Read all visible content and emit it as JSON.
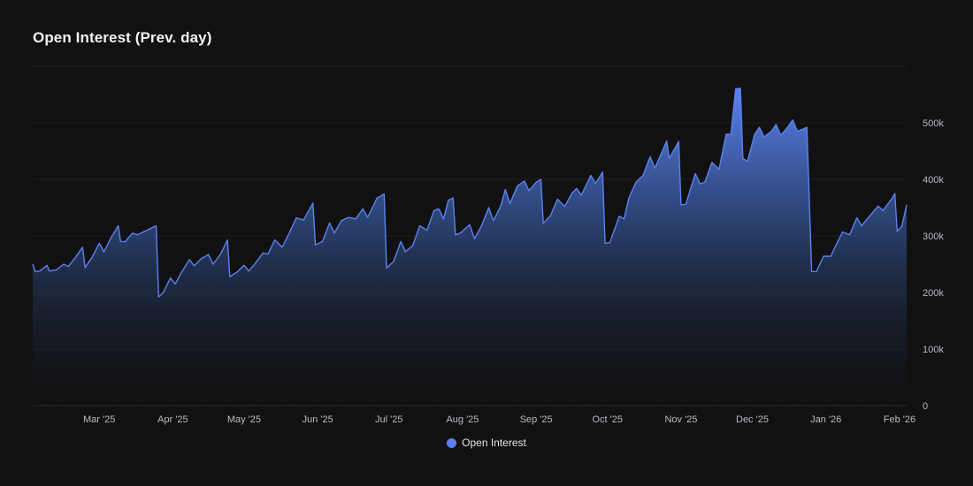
{
  "title": "Open Interest (Prev. day)",
  "legend": {
    "label": "Open Interest",
    "color": "#5b82f0"
  },
  "chart_data": {
    "type": "area",
    "title": "Open Interest (Prev. day)",
    "y_axis_position": "right",
    "grid": true,
    "legend_position": "bottom-center",
    "ylim": [
      0,
      600000
    ],
    "yticks": [
      0,
      100000,
      200000,
      300000,
      400000,
      500000
    ],
    "ytick_labels": [
      "0",
      "100k",
      "200k",
      "300k",
      "400k",
      "500k"
    ],
    "xticks": [
      {
        "date": "2025-03-01",
        "label": "Mar '25"
      },
      {
        "date": "2025-04-01",
        "label": "Apr '25"
      },
      {
        "date": "2025-05-01",
        "label": "May '25"
      },
      {
        "date": "2025-06-01",
        "label": "Jun '25"
      },
      {
        "date": "2025-07-01",
        "label": "Jul '25"
      },
      {
        "date": "2025-08-01",
        "label": "Aug '25"
      },
      {
        "date": "2025-09-01",
        "label": "Sep '25"
      },
      {
        "date": "2025-10-01",
        "label": "Oct '25"
      },
      {
        "date": "2025-11-01",
        "label": "Nov '25"
      },
      {
        "date": "2025-12-01",
        "label": "Dec '25"
      },
      {
        "date": "2026-01-01",
        "label": "Jan '26"
      },
      {
        "date": "2026-02-01",
        "label": "Feb '26"
      }
    ],
    "x_range": [
      "2025-02-01",
      "2026-02-01"
    ],
    "series": [
      {
        "name": "Open Interest",
        "color": "#5b82f0",
        "points": [
          [
            "2025-02-01",
            250000
          ],
          [
            "2025-02-02",
            237000
          ],
          [
            "2025-02-04",
            238000
          ],
          [
            "2025-02-07",
            248000
          ],
          [
            "2025-02-08",
            238000
          ],
          [
            "2025-02-11",
            240000
          ],
          [
            "2025-02-14",
            250000
          ],
          [
            "2025-02-16",
            246000
          ],
          [
            "2025-02-19",
            262000
          ],
          [
            "2025-02-22",
            280000
          ],
          [
            "2025-02-23",
            244000
          ],
          [
            "2025-02-26",
            262000
          ],
          [
            "2025-03-01",
            287000
          ],
          [
            "2025-03-03",
            272000
          ],
          [
            "2025-03-06",
            297000
          ],
          [
            "2025-03-09",
            318000
          ],
          [
            "2025-03-10",
            290000
          ],
          [
            "2025-03-12",
            290000
          ],
          [
            "2025-03-15",
            305000
          ],
          [
            "2025-03-17",
            302000
          ],
          [
            "2025-03-21",
            310000
          ],
          [
            "2025-03-25",
            318000
          ],
          [
            "2025-03-26",
            192000
          ],
          [
            "2025-03-28",
            200000
          ],
          [
            "2025-03-31",
            226000
          ],
          [
            "2025-04-02",
            215000
          ],
          [
            "2025-04-05",
            238000
          ],
          [
            "2025-04-08",
            258000
          ],
          [
            "2025-04-10",
            247000
          ],
          [
            "2025-04-13",
            260000
          ],
          [
            "2025-04-16",
            267000
          ],
          [
            "2025-04-18",
            250000
          ],
          [
            "2025-04-21",
            267000
          ],
          [
            "2025-04-24",
            293000
          ],
          [
            "2025-04-25",
            228000
          ],
          [
            "2025-04-28",
            236000
          ],
          [
            "2025-05-01",
            248000
          ],
          [
            "2025-05-03",
            238000
          ],
          [
            "2025-05-06",
            253000
          ],
          [
            "2025-05-09",
            270000
          ],
          [
            "2025-05-11",
            268000
          ],
          [
            "2025-05-14",
            293000
          ],
          [
            "2025-05-17",
            280000
          ],
          [
            "2025-05-20",
            305000
          ],
          [
            "2025-05-23",
            332000
          ],
          [
            "2025-05-26",
            328000
          ],
          [
            "2025-05-30",
            358000
          ],
          [
            "2025-05-31",
            284000
          ],
          [
            "2025-06-03",
            290000
          ],
          [
            "2025-06-06",
            323000
          ],
          [
            "2025-06-08",
            305000
          ],
          [
            "2025-06-11",
            327000
          ],
          [
            "2025-06-14",
            333000
          ],
          [
            "2025-06-17",
            330000
          ],
          [
            "2025-06-20",
            348000
          ],
          [
            "2025-06-22",
            333000
          ],
          [
            "2025-06-26",
            367000
          ],
          [
            "2025-06-29",
            374000
          ],
          [
            "2025-06-30",
            243000
          ],
          [
            "2025-07-03",
            255000
          ],
          [
            "2025-07-06",
            290000
          ],
          [
            "2025-07-08",
            272000
          ],
          [
            "2025-07-11",
            283000
          ],
          [
            "2025-07-14",
            318000
          ],
          [
            "2025-07-17",
            310000
          ],
          [
            "2025-07-20",
            345000
          ],
          [
            "2025-07-22",
            348000
          ],
          [
            "2025-07-24",
            330000
          ],
          [
            "2025-07-26",
            363000
          ],
          [
            "2025-07-28",
            367000
          ],
          [
            "2025-07-29",
            302000
          ],
          [
            "2025-07-31",
            305000
          ],
          [
            "2025-08-04",
            320000
          ],
          [
            "2025-08-06",
            295000
          ],
          [
            "2025-08-09",
            318000
          ],
          [
            "2025-08-12",
            350000
          ],
          [
            "2025-08-14",
            327000
          ],
          [
            "2025-08-17",
            352000
          ],
          [
            "2025-08-19",
            382000
          ],
          [
            "2025-08-21",
            357000
          ],
          [
            "2025-08-24",
            388000
          ],
          [
            "2025-08-27",
            397000
          ],
          [
            "2025-08-29",
            380000
          ],
          [
            "2025-09-01",
            395000
          ],
          [
            "2025-09-03",
            400000
          ],
          [
            "2025-09-04",
            322000
          ],
          [
            "2025-09-07",
            336000
          ],
          [
            "2025-09-10",
            365000
          ],
          [
            "2025-09-13",
            352000
          ],
          [
            "2025-09-16",
            375000
          ],
          [
            "2025-09-18",
            384000
          ],
          [
            "2025-09-20",
            372000
          ],
          [
            "2025-09-24",
            407000
          ],
          [
            "2025-09-26",
            393000
          ],
          [
            "2025-09-29",
            413000
          ],
          [
            "2025-09-30",
            287000
          ],
          [
            "2025-10-02",
            288000
          ],
          [
            "2025-10-06",
            335000
          ],
          [
            "2025-10-08",
            330000
          ],
          [
            "2025-10-10",
            367000
          ],
          [
            "2025-10-13",
            395000
          ],
          [
            "2025-10-16",
            407000
          ],
          [
            "2025-10-19",
            440000
          ],
          [
            "2025-10-21",
            420000
          ],
          [
            "2025-10-26",
            468000
          ],
          [
            "2025-10-27",
            437000
          ],
          [
            "2025-10-31",
            467000
          ],
          [
            "2025-11-01",
            355000
          ],
          [
            "2025-11-03",
            356000
          ],
          [
            "2025-11-07",
            410000
          ],
          [
            "2025-11-09",
            392000
          ],
          [
            "2025-11-11",
            395000
          ],
          [
            "2025-11-14",
            430000
          ],
          [
            "2025-11-17",
            418000
          ],
          [
            "2025-11-20",
            480000
          ],
          [
            "2025-11-22",
            480000
          ],
          [
            "2025-11-24",
            560000
          ],
          [
            "2025-11-26",
            561000
          ],
          [
            "2025-11-27",
            437000
          ],
          [
            "2025-11-29",
            432000
          ],
          [
            "2025-12-02",
            480000
          ],
          [
            "2025-12-04",
            492000
          ],
          [
            "2025-12-06",
            475000
          ],
          [
            "2025-12-09",
            485000
          ],
          [
            "2025-12-11",
            497000
          ],
          [
            "2025-12-13",
            478000
          ],
          [
            "2025-12-16",
            493000
          ],
          [
            "2025-12-18",
            505000
          ],
          [
            "2025-12-20",
            485000
          ],
          [
            "2025-12-24",
            492000
          ],
          [
            "2025-12-26",
            237000
          ],
          [
            "2025-12-28",
            237000
          ],
          [
            "2025-12-31",
            264000
          ],
          [
            "2026-01-03",
            264000
          ],
          [
            "2026-01-06",
            290000
          ],
          [
            "2026-01-08",
            307000
          ],
          [
            "2026-01-11",
            302000
          ],
          [
            "2026-01-14",
            332000
          ],
          [
            "2026-01-16",
            318000
          ],
          [
            "2026-01-20",
            338000
          ],
          [
            "2026-01-23",
            353000
          ],
          [
            "2026-01-25",
            345000
          ],
          [
            "2026-01-29",
            367000
          ],
          [
            "2026-01-30",
            375000
          ],
          [
            "2026-01-31",
            308000
          ],
          [
            "2026-02-02",
            317000
          ],
          [
            "2026-02-04",
            355000
          ]
        ]
      }
    ]
  }
}
